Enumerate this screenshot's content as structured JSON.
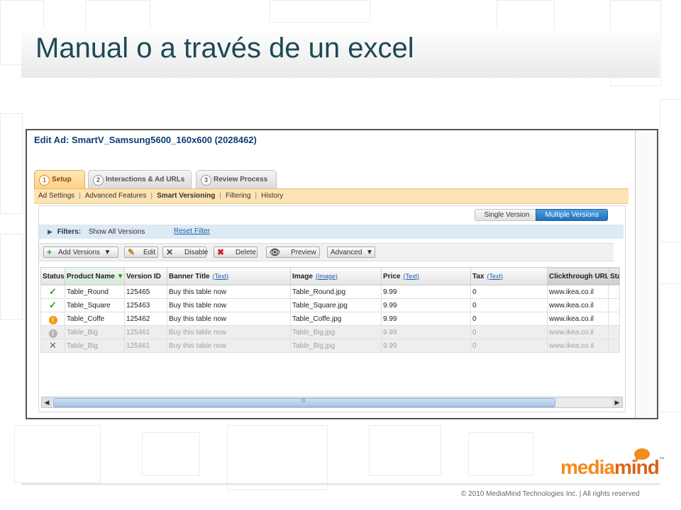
{
  "slide": {
    "title": "Manual o a través de un excel",
    "copyright": "© 2010 MediaMind Technologies Inc. | All rights reserved",
    "logo": {
      "text_a": "media",
      "text_b": "mind",
      "tm": "™"
    }
  },
  "app": {
    "ad_title_prefix": "Edit Ad:",
    "ad_title_name": "SmartV_Samsung5600_160x600 (2028462)",
    "tabs": [
      {
        "num": "1",
        "label": "Setup",
        "active": true
      },
      {
        "num": "2",
        "label": "Interactions & Ad URLs",
        "active": false
      },
      {
        "num": "3",
        "label": "Review Process",
        "active": false
      }
    ],
    "subnav": [
      "Ad Settings",
      "Advanced Features",
      "Smart Versioning",
      "Filtering",
      "History"
    ],
    "subnav_sep": "|",
    "version_toggle": {
      "single": "Single Version",
      "multiple": "Multiple Versions"
    },
    "filters": {
      "label": "Filters:",
      "value": "Show All Versions",
      "reset": "Reset Filter"
    },
    "toolbar": {
      "add_versions": "Add Versions",
      "edit": "Edit",
      "disable": "Disable",
      "delete": "Delete",
      "preview": "Preview",
      "advanced": "Advanced"
    },
    "grid": {
      "columns": {
        "status": "Status",
        "product_name": "Product Name",
        "version_id": "Version ID",
        "banner_title": "Banner Title",
        "banner_title_type": "(Text)",
        "image": "Image",
        "image_type": "(Image)",
        "price": "Price",
        "price_type": "(Text)",
        "tax": "Tax",
        "tax_type": "(Text)",
        "clickthrough": "Clickthrough URL",
        "extra": "Sta"
      },
      "rows": [
        {
          "status": "ok",
          "status_glyph": "✓",
          "product": "Table_Round",
          "version": "125465",
          "banner": "Buy this table now",
          "image": "Table_Round.jpg",
          "price": "9.99",
          "tax": "0",
          "url": "www.ikea.co.il",
          "dim": false
        },
        {
          "status": "ok",
          "status_glyph": "✓",
          "product": "Table_Square",
          "version": "125463",
          "banner": "Buy this table now",
          "image": "Table_Square.jpg",
          "price": "9.99",
          "tax": "0",
          "url": "www.ikea.co.il",
          "dim": false
        },
        {
          "status": "warn",
          "status_glyph": "!",
          "product": "Table_Coffe",
          "version": "125462",
          "banner": "Buy this table now",
          "image": "Table_Coffe.jpg",
          "price": "9.99",
          "tax": "0",
          "url": "www.ikea.co.il",
          "dim": false
        },
        {
          "status": "warn-dim",
          "status_glyph": "!",
          "product": "Table_Big",
          "version": "125461",
          "banner": "Buy this table now",
          "image": "Table_Big.jpg",
          "price": "9.99",
          "tax": "0",
          "url": "www.ikea.co.il",
          "dim": true
        },
        {
          "status": "x",
          "status_glyph": "✕",
          "product": "Table_Big",
          "version": "125461",
          "banner": "Buy this table now",
          "image": "Table_Big.jpg",
          "price": "9.99",
          "tax": "0",
          "url": "www.ikea.co.il",
          "dim": true
        }
      ]
    },
    "scroll_mid": "III"
  },
  "colors": {
    "title": "#1c4a56",
    "accent_orange": "#f28b1d",
    "link_blue": "#1d5eb0",
    "toggle_blue": "#2470bb"
  }
}
